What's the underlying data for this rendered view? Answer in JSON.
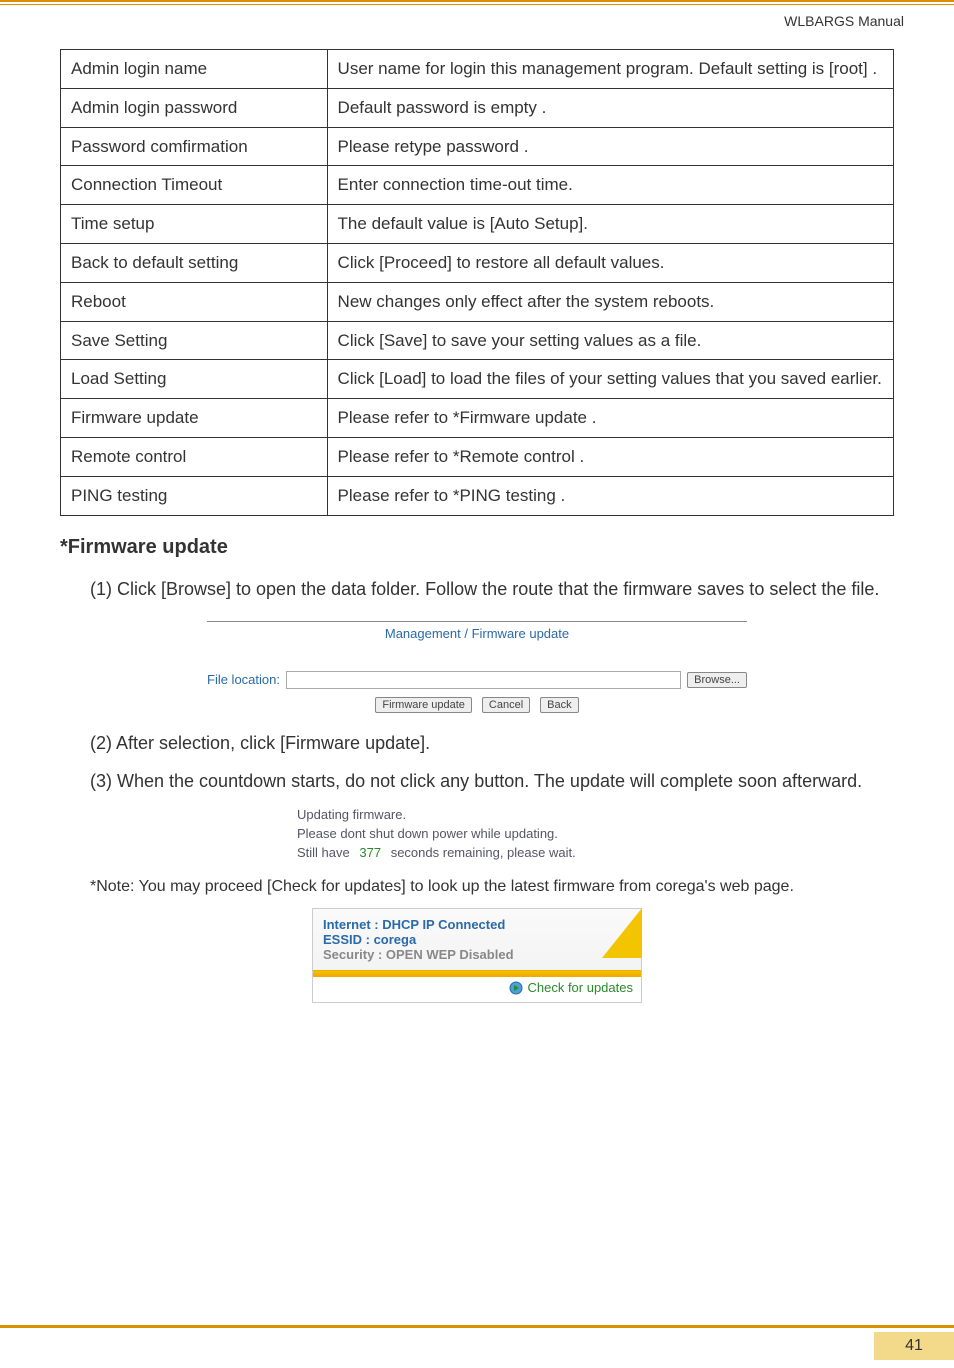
{
  "doc_header": "WLBARGS Manual",
  "table": {
    "rows": [
      {
        "label": "Admin login name",
        "desc": "User name for login this management program. Default setting is [root] ."
      },
      {
        "label": "Admin login password",
        "desc": "Default password is empty ."
      },
      {
        "label": "Password comfirmation",
        "desc": "Please retype password ."
      },
      {
        "label": "Connection Timeout",
        "desc": "Enter connection time-out time."
      },
      {
        "label": "Time setup",
        "desc": "The default value is [Auto Setup]."
      },
      {
        "label": "Back to default setting",
        "desc": "Click [Proceed] to restore all default values."
      },
      {
        "label": "Reboot",
        "desc": "New changes only effect after the system reboots."
      },
      {
        "label": "Save Setting",
        "desc": "Click [Save] to save your setting values as a file."
      },
      {
        "label": "Load Setting",
        "desc": "Click [Load] to load the files of your setting values that you saved earlier."
      },
      {
        "label": "Firmware update",
        "desc": "Please refer to *Firmware update ."
      },
      {
        "label": "Remote control",
        "desc": "Please refer to *Remote control ."
      },
      {
        "label": "PING testing",
        "desc": "Please refer to *PING testing ."
      }
    ]
  },
  "section_title": "*Firmware update",
  "steps": {
    "s1": "(1) Click [Browse] to open the data folder.  Follow the route that the firmware saves to select the file.",
    "s2": "(2) After selection, click [Firmware update].",
    "s3": "(3) When the countdown starts, do not click any button.  The update will complete soon afterward."
  },
  "fw_panel": {
    "title": "Management / Firmware update",
    "file_label": "File location:",
    "browse": "Browse...",
    "btn_update": "Firmware update",
    "btn_cancel": "Cancel",
    "btn_back": "Back"
  },
  "updating_panel": {
    "l1": "Updating firmware.",
    "l2": "Please dont shut down power while updating.",
    "l3_pre": "Still have",
    "l3_seconds": "377",
    "l3_post": "seconds remaining, please wait."
  },
  "note": "*Note: You may proceed [Check for updates] to look up the latest firmware from corega's web page.",
  "status": {
    "internet_label": "Internet",
    "internet_value": ": DHCP IP Connected",
    "essid_label": "ESSID",
    "essid_value": ": corega",
    "security_label": "Security",
    "security_value": ": OPEN  WEP Disabled",
    "check": "Check for updates"
  },
  "page_number": "41"
}
